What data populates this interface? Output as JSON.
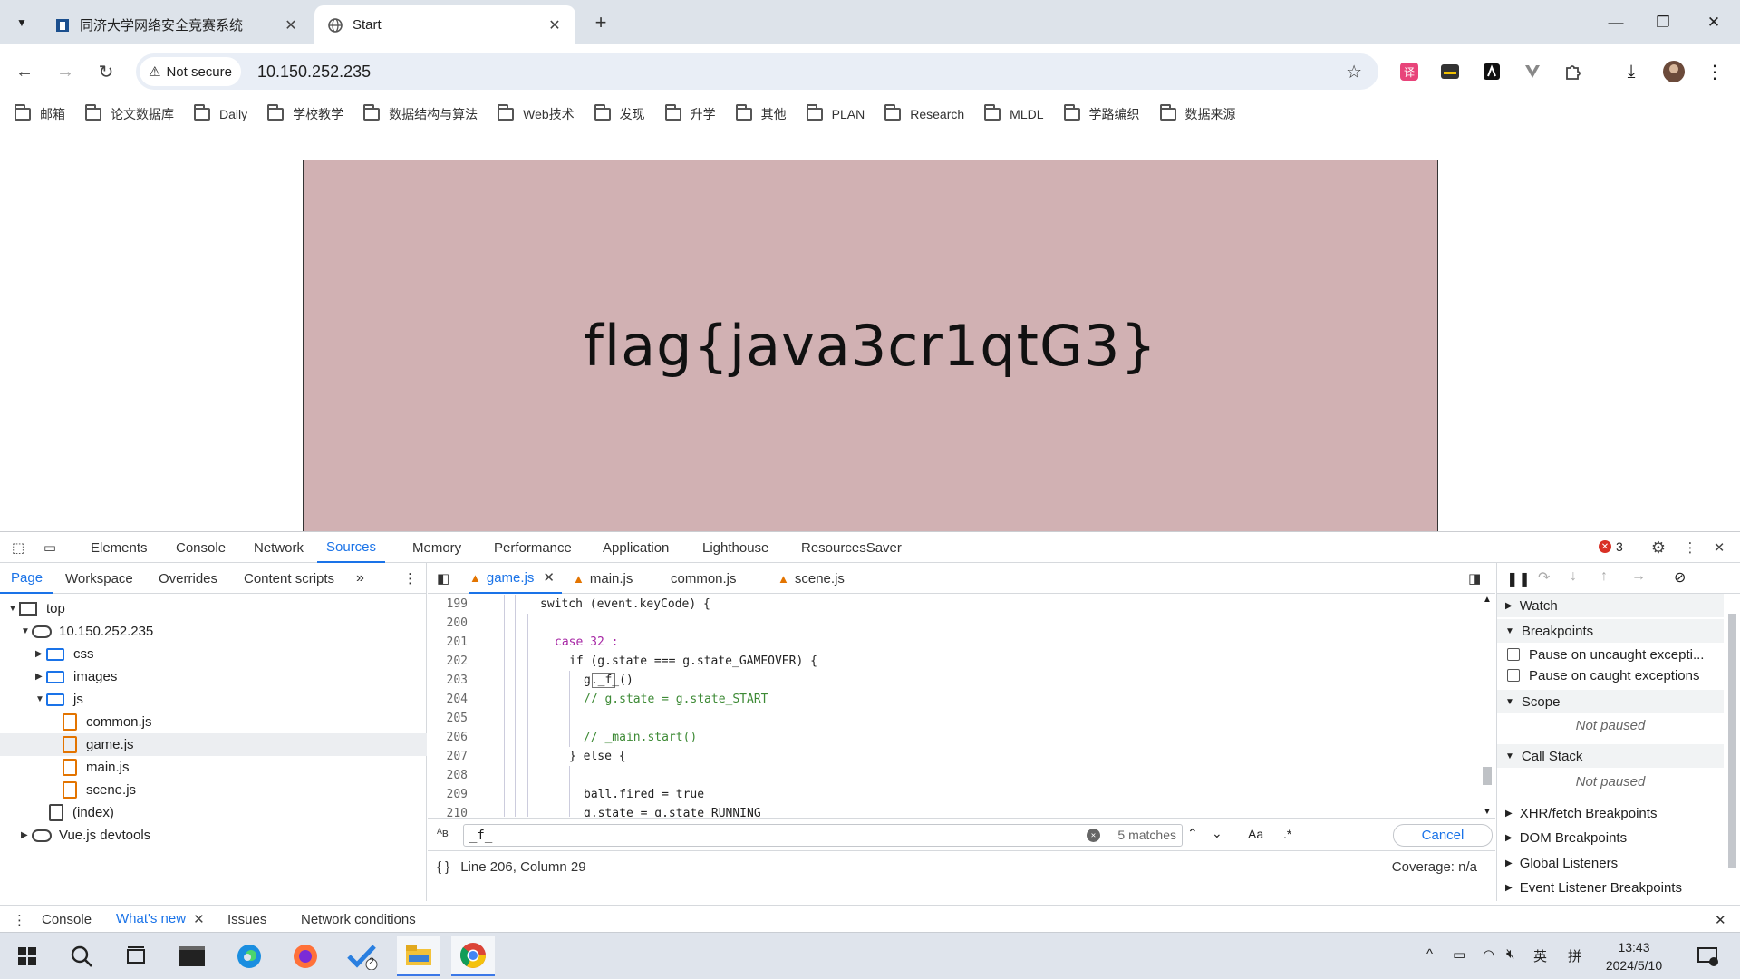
{
  "browser": {
    "tabs": [
      {
        "title": "同济大学网络安全竞赛系统",
        "icon": "tongji-favicon"
      },
      {
        "title": "Start",
        "icon": "globe-icon"
      }
    ],
    "address": {
      "security_label": "Not secure",
      "url": "10.150.252.235"
    },
    "bookmarks": [
      "邮箱",
      "论文数据库",
      "Daily",
      "学校教学",
      "数据结构与算法",
      "Web技术",
      "发现",
      "升学",
      "其他",
      "PLAN",
      "Research",
      "MLDL",
      "学路编织",
      "数据来源"
    ]
  },
  "page": {
    "flag_text": "flag{java3cr1qtG3}"
  },
  "devtools": {
    "main_tabs": [
      "Elements",
      "Console",
      "Network",
      "Sources",
      "Memory",
      "Performance",
      "Application",
      "Lighthouse",
      "ResourcesSaver"
    ],
    "selected_tab": "Sources",
    "error_count": "3",
    "navigator_tabs": [
      "Page",
      "Workspace",
      "Overrides",
      "Content scripts"
    ],
    "tree": {
      "top": "top",
      "host": "10.150.252.235",
      "css": "css",
      "images": "images",
      "js": "js",
      "files": [
        "common.js",
        "game.js",
        "main.js",
        "scene.js"
      ],
      "index": "(index)",
      "vue": "Vue.js devtools"
    },
    "editor_tabs": [
      {
        "name": "game.js",
        "warning": true
      },
      {
        "name": "main.js",
        "warning": true
      },
      {
        "name": "common.js",
        "warning": false
      },
      {
        "name": "scene.js",
        "warning": true
      }
    ],
    "code_lines": [
      {
        "n": "199",
        "text": "switch (event.keyCode) {"
      },
      {
        "n": "200",
        "text": ""
      },
      {
        "n": "201",
        "text": "case 32 :"
      },
      {
        "n": "202",
        "text": "if (g.state === g.state_GAMEOVER) {"
      },
      {
        "n": "203",
        "text": "g._f_()"
      },
      {
        "n": "204",
        "text": "// g.state = g.state_START"
      },
      {
        "n": "205",
        "text": ""
      },
      {
        "n": "206",
        "text": "// _main.start()"
      },
      {
        "n": "207",
        "text": "} else {"
      },
      {
        "n": "208",
        "text": ""
      },
      {
        "n": "209",
        "text": "ball.fired = true"
      },
      {
        "n": "210",
        "text": "g.state = g.state_RUNNING"
      },
      {
        "n": "211",
        "text": "}"
      }
    ],
    "search": {
      "query": "_f_",
      "matches": "5 matches",
      "case_label": "Aa",
      "regex_label": ".*",
      "cancel": "Cancel"
    },
    "status": {
      "position": "Line 206, Column 29",
      "coverage": "Coverage: n/a"
    },
    "debugger": {
      "watch": "Watch",
      "breakpoints": "Breakpoints",
      "pause_uncaught": "Pause on uncaught excepti...",
      "pause_caught": "Pause on caught exceptions",
      "scope": "Scope",
      "not_paused": "Not paused",
      "call_stack": "Call Stack",
      "xhr": "XHR/fetch Breakpoints",
      "dom": "DOM Breakpoints",
      "global": "Global Listeners",
      "event": "Event Listener Breakpoints"
    },
    "drawer_tabs": [
      "Console",
      "What's new",
      "Issues",
      "Network conditions"
    ]
  },
  "taskbar": {
    "time": "13:43",
    "date": "2024/5/10",
    "ime": "英",
    "ime2": "拼",
    "badge": "2"
  }
}
